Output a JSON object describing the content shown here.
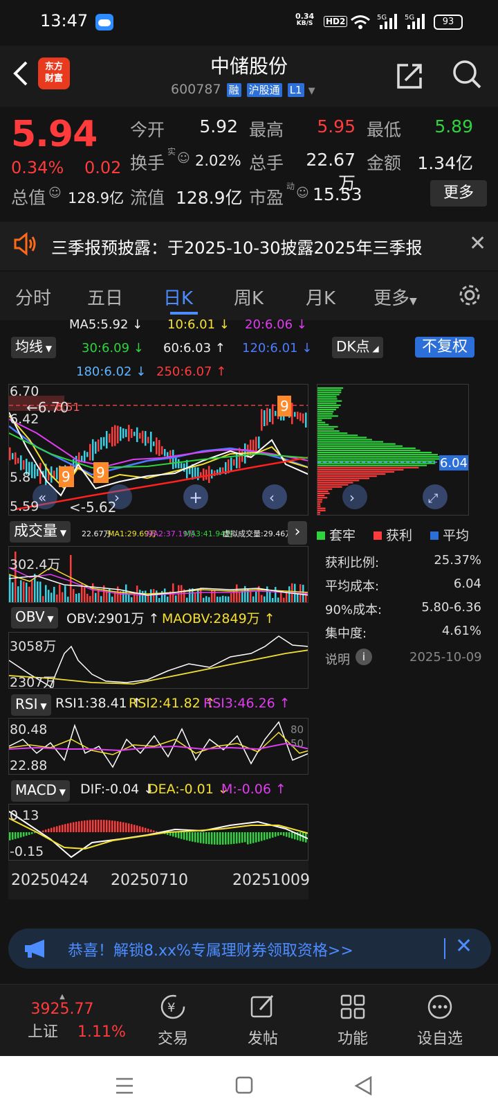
{
  "status": {
    "time": "13:47",
    "net_speed": "0.34",
    "net_unit": "KB/S",
    "hd": "HD2",
    "battery": "93"
  },
  "header": {
    "logo_line1": "东方",
    "logo_line2": "财富",
    "stock_name": "中储股份",
    "stock_code": "600787",
    "tag1": "融",
    "tag2": "沪股通",
    "tag3": "L1"
  },
  "quote": {
    "price": "5.94",
    "change_pct": "0.34%",
    "change_amt": "0.02",
    "open_label": "今开",
    "open": "5.92",
    "high_label": "最高",
    "high": "5.95",
    "low_label": "最低",
    "low": "5.89",
    "turnover_label": "换手",
    "turnover_sup": "实",
    "turnover": "2.02%",
    "volume_label": "总手",
    "volume": "22.67万",
    "amount_label": "金额",
    "amount": "1.34亿",
    "mktcap_label": "总值",
    "mktcap": "128.9亿",
    "float_label": "流值",
    "float_cap": "128.9亿",
    "pe_label": "市盈",
    "pe_sup": "动",
    "pe": "15.53",
    "more": "更多"
  },
  "notice": {
    "text": "三季报预披露：于2025-10-30披露2025年三季报"
  },
  "tabs": [
    "分时",
    "五日",
    "日K",
    "周K",
    "月K",
    "更多"
  ],
  "ma": {
    "ma5": "MA5:5.92",
    "ma10": "10:6.01",
    "ma20": "20:6.06",
    "ma30": "30:6.09",
    "ma60": "60:6.03",
    "ma120": "120:6.01",
    "ma180": "180:6.02",
    "ma250": "250:6.07",
    "select": "均线",
    "dk": "DK点",
    "fq": "不复权"
  },
  "kline": {
    "y_top": "6.70",
    "y_mid1": "6.42",
    "y_mid2": "5.8",
    "y_bottom": "5.59",
    "high_mark": "6.70",
    "dash_price": "6.51",
    "low_mark": "<-5.62"
  },
  "volume": {
    "select": "成交量",
    "v1": "22.67万",
    "ma1": "MA1:29.69万",
    "ma2": "MA2:37.19万",
    "ma3": "MA3:41.94万",
    "virt": "虚拟成交量:29.46万",
    "y_top": "302.4万"
  },
  "obv": {
    "select": "OBV",
    "obv": "OBV:2901万",
    "maobv": "MAOBV:2849万",
    "y_top": "3058万",
    "y_bottom": "2307万"
  },
  "rsi": {
    "select": "RSI",
    "rsi1": "RSI1:38.41",
    "rsi2": "RSI2:41.82",
    "rsi3": "RSI3:46.26",
    "y_top": "80.48",
    "y_bottom": "22.88",
    "r80": "80",
    "r50": "50"
  },
  "macd": {
    "select": "MACD",
    "dif": "DIF:-0.04",
    "dea": "DEA:-0.01",
    "m": "M:-0.06",
    "y_top": "0.13",
    "y_bottom": "-0.15"
  },
  "dates": [
    "20250424",
    "20250710",
    "20251009"
  ],
  "chips": {
    "avg_marker": "6.04",
    "legend": [
      "套牢",
      "获利",
      "平均"
    ],
    "rows": [
      {
        "label": "获利比例:",
        "value": "25.37%"
      },
      {
        "label": "平均成本:",
        "value": "6.04"
      },
      {
        "label": "90%成本:",
        "value": "5.80-6.36"
      },
      {
        "label": "集中度:",
        "value": "4.61%"
      }
    ],
    "note_label": "说明",
    "note_date": "2025-10-09"
  },
  "promo": {
    "text": "恭喜！解锁8.xx%专属理财券领取资格>>"
  },
  "bottom_nav": {
    "index_value": "3925.77",
    "index_name": "上证",
    "index_change": "1.11%",
    "trade": "交易",
    "post": "发帖",
    "func": "功能",
    "watch": "设自选"
  },
  "colors": {
    "up": "#ff3b3b",
    "down": "#2ed33d",
    "accent": "#4d8dff"
  }
}
